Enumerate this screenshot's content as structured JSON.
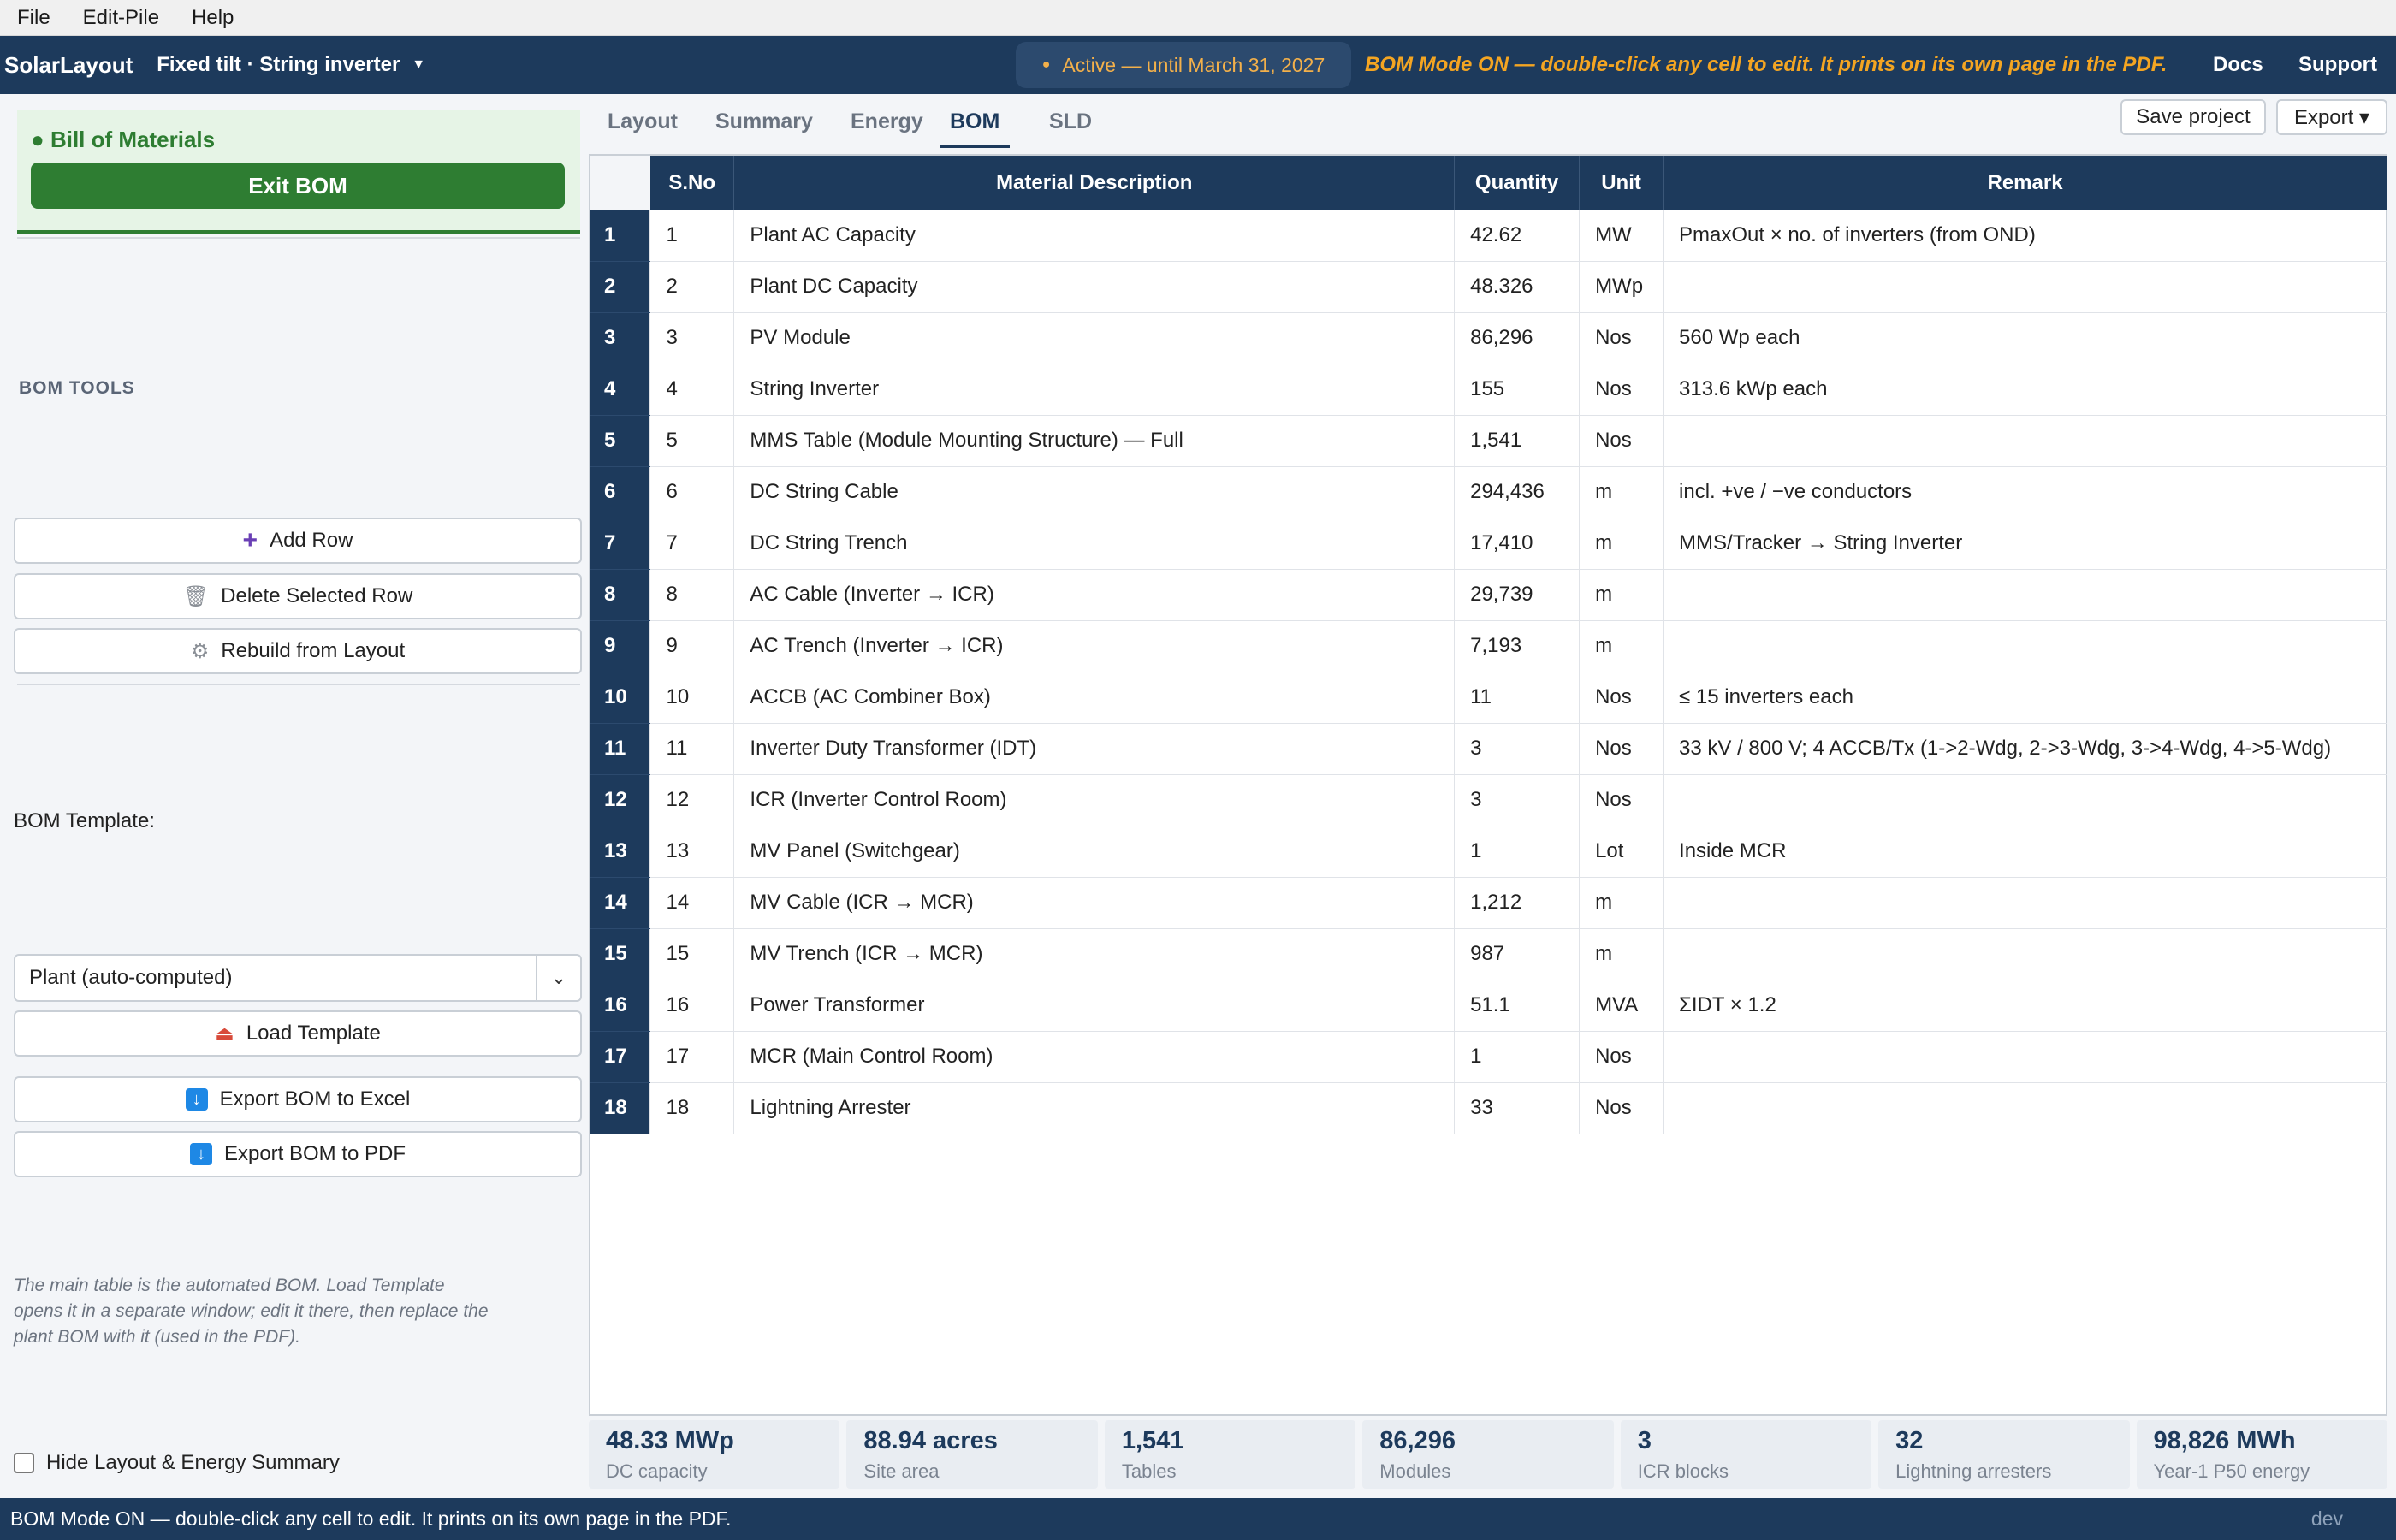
{
  "menu": [
    "File",
    "Edit-Pile",
    "Help"
  ],
  "header": {
    "brand": "SolarLayout",
    "mode": "Fixed tilt · String inverter",
    "license": "Active — until March 31, 2027",
    "bom_note": "BOM Mode ON — double-click any cell to edit. It prints on its own page in the PDF.",
    "docs": "Docs",
    "support": "Support"
  },
  "sidebar": {
    "panel_title": "Bill of Materials",
    "exit_label": "Exit BOM",
    "tools_title": "BOM TOOLS",
    "add_row": "Add Row",
    "delete_row": "Delete Selected Row",
    "rebuild": "Rebuild from Layout",
    "template_label": "BOM Template:",
    "template_value": "Plant (auto-computed)",
    "load_template": "Load Template",
    "export_excel": "Export BOM to Excel",
    "export_pdf": "Export BOM to PDF",
    "hint": "The main table is the automated BOM. Load Template opens it in a separate window; edit it there, then replace the plant BOM with it (used in the PDF).",
    "hide_summary": "Hide Layout & Energy Summary"
  },
  "tabs": [
    "Layout",
    "Summary",
    "Energy",
    "BOM",
    "SLD"
  ],
  "actions": {
    "save": "Save project",
    "export": "Export ▾"
  },
  "table": {
    "headers": [
      "S.No",
      "Material Description",
      "Quantity",
      "Unit",
      "Remark"
    ],
    "rows": [
      {
        "idx": "1",
        "sno": "1",
        "desc": "Plant AC Capacity",
        "qty": "42.62",
        "unit": "MW",
        "remark": "PmaxOut × no. of inverters (from OND)"
      },
      {
        "idx": "2",
        "sno": "2",
        "desc": "Plant DC Capacity",
        "qty": "48.326",
        "unit": "MWp",
        "remark": ""
      },
      {
        "idx": "3",
        "sno": "3",
        "desc": "PV Module",
        "qty": "86,296",
        "unit": "Nos",
        "remark": "560 Wp each"
      },
      {
        "idx": "4",
        "sno": "4",
        "desc": "String Inverter",
        "qty": "155",
        "unit": "Nos",
        "remark": "313.6 kWp each"
      },
      {
        "idx": "5",
        "sno": "5",
        "desc": "MMS Table (Module Mounting Structure) — Full",
        "qty": "1,541",
        "unit": "Nos",
        "remark": ""
      },
      {
        "idx": "6",
        "sno": "6",
        "desc": "DC String Cable",
        "qty": "294,436",
        "unit": "m",
        "remark": "incl. +ve / −ve conductors"
      },
      {
        "idx": "7",
        "sno": "7",
        "desc": "DC String Trench",
        "qty": "17,410",
        "unit": "m",
        "remark": "MMS/Tracker → String Inverter"
      },
      {
        "idx": "8",
        "sno": "8",
        "desc": "AC Cable (Inverter → ICR)",
        "qty": "29,739",
        "unit": "m",
        "remark": ""
      },
      {
        "idx": "9",
        "sno": "9",
        "desc": "AC Trench (Inverter → ICR)",
        "qty": "7,193",
        "unit": "m",
        "remark": ""
      },
      {
        "idx": "10",
        "sno": "10",
        "desc": "ACCB (AC Combiner Box)",
        "qty": "11",
        "unit": "Nos",
        "remark": "≤ 15 inverters each"
      },
      {
        "idx": "11",
        "sno": "11",
        "desc": "Inverter Duty Transformer (IDT)",
        "qty": "3",
        "unit": "Nos",
        "remark": "33 kV / 800 V; 4 ACCB/Tx (1->2-Wdg, 2->3-Wdg, 3->4-Wdg, 4->5-Wdg)"
      },
      {
        "idx": "12",
        "sno": "12",
        "desc": "ICR (Inverter Control Room)",
        "qty": "3",
        "unit": "Nos",
        "remark": ""
      },
      {
        "idx": "13",
        "sno": "13",
        "desc": "MV Panel (Switchgear)",
        "qty": "1",
        "unit": "Lot",
        "remark": "Inside MCR"
      },
      {
        "idx": "14",
        "sno": "14",
        "desc": "MV Cable (ICR → MCR)",
        "qty": "1,212",
        "unit": "m",
        "remark": ""
      },
      {
        "idx": "15",
        "sno": "15",
        "desc": "MV Trench (ICR → MCR)",
        "qty": "987",
        "unit": "m",
        "remark": ""
      },
      {
        "idx": "16",
        "sno": "16",
        "desc": "Power Transformer",
        "qty": "51.1",
        "unit": "MVA",
        "remark": "ΣIDT × 1.2"
      },
      {
        "idx": "17",
        "sno": "17",
        "desc": "MCR (Main Control Room)",
        "qty": "1",
        "unit": "Nos",
        "remark": ""
      },
      {
        "idx": "18",
        "sno": "18",
        "desc": "Lightning Arrester",
        "qty": "33",
        "unit": "Nos",
        "remark": ""
      }
    ]
  },
  "stats": [
    {
      "value": "48.33 MWp",
      "label": "DC capacity"
    },
    {
      "value": "88.94 acres",
      "label": "Site area"
    },
    {
      "value": "1,541",
      "label": "Tables"
    },
    {
      "value": "86,296",
      "label": "Modules"
    },
    {
      "value": "3",
      "label": "ICR blocks"
    },
    {
      "value": "32",
      "label": "Lightning arresters"
    },
    {
      "value": "98,826 MWh",
      "label": "Year-1 P50 energy"
    }
  ],
  "status": {
    "text": "BOM Mode ON — double-click any cell to edit. It prints on its own page in the PDF.",
    "env": "dev"
  }
}
